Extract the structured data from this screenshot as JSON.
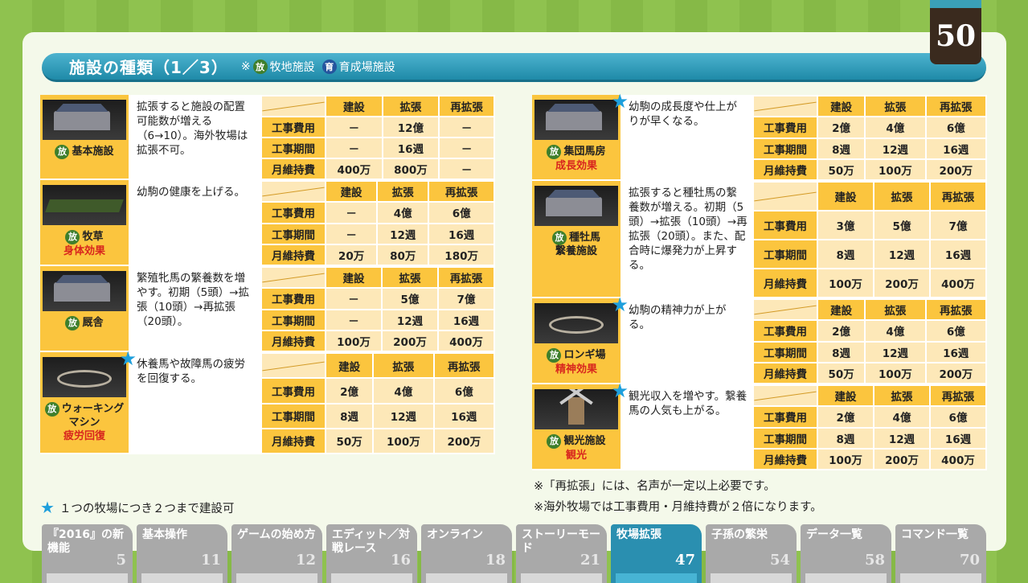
{
  "page_number": "50",
  "title": "施設の種類（1／3）",
  "note": {
    "prefix": "※",
    "badge_pasture": "放",
    "pasture_label": "牧地施設",
    "badge_training": "育",
    "training_label": "育成場施設"
  },
  "table_headers": [
    "建設",
    "拡張",
    "再拡張"
  ],
  "row_labels": [
    "工事費用",
    "工事期間",
    "月維持費"
  ],
  "left_facilities": [
    {
      "badge": "放",
      "name": "基本施設",
      "effect": "",
      "star": false,
      "desc": "拡張すると施設の配置可能数が増える（6→10）。海外牧場は拡張不可。",
      "costs": [
        [
          "－",
          "12億",
          "－"
        ],
        [
          "－",
          "16週",
          "－"
        ],
        [
          "400万",
          "800万",
          "－"
        ]
      ]
    },
    {
      "badge": "放",
      "name": "牧草",
      "effect": "身体効果",
      "star": false,
      "desc": "幼駒の健康を上げる。",
      "costs": [
        [
          "－",
          "4億",
          "6億"
        ],
        [
          "－",
          "12週",
          "16週"
        ],
        [
          "20万",
          "80万",
          "180万"
        ]
      ]
    },
    {
      "badge": "放",
      "name": "厩舎",
      "effect": "",
      "star": false,
      "desc": "繁殖牝馬の繁養数を増やす。初期（5頭）→拡張（10頭）→再拡張（20頭）。",
      "costs": [
        [
          "－",
          "5億",
          "7億"
        ],
        [
          "－",
          "12週",
          "16週"
        ],
        [
          "100万",
          "200万",
          "400万"
        ]
      ]
    },
    {
      "badge": "放",
      "name": "ウォーキング",
      "name2": "マシン",
      "effect": "疲労回復",
      "star": true,
      "desc": "休養馬や故障馬の疲労を回復する。",
      "costs": [
        [
          "2億",
          "4億",
          "6億"
        ],
        [
          "8週",
          "12週",
          "16週"
        ],
        [
          "50万",
          "100万",
          "200万"
        ]
      ]
    }
  ],
  "right_facilities": [
    {
      "badge": "放",
      "name": "集団馬房",
      "effect": "成長効果",
      "star": true,
      "desc": "幼駒の成長度や仕上がりが早くなる。",
      "costs": [
        [
          "2億",
          "4億",
          "6億"
        ],
        [
          "8週",
          "12週",
          "16週"
        ],
        [
          "50万",
          "100万",
          "200万"
        ]
      ]
    },
    {
      "badge": "放",
      "name": "種牡馬",
      "name2": "繋養施設",
      "effect": "",
      "star": false,
      "desc": "拡張すると種牡馬の繋養数が増える。初期（5頭）→拡張（10頭）→再拡張（20頭）。また、配合時に爆発力が上昇する。",
      "costs": [
        [
          "3億",
          "5億",
          "7億"
        ],
        [
          "8週",
          "12週",
          "16週"
        ],
        [
          "100万",
          "200万",
          "400万"
        ]
      ]
    },
    {
      "badge": "放",
      "name": "ロンギ場",
      "effect": "精神効果",
      "star": true,
      "desc": "幼駒の精神力が上がる。",
      "costs": [
        [
          "2億",
          "4億",
          "6億"
        ],
        [
          "8週",
          "12週",
          "16週"
        ],
        [
          "50万",
          "100万",
          "200万"
        ]
      ]
    },
    {
      "badge": "放",
      "name": "観光施設",
      "effect": "観光",
      "star": true,
      "desc": "観光収入を増やす。繋養馬の人気も上がる。",
      "costs": [
        [
          "2億",
          "4億",
          "6億"
        ],
        [
          "8週",
          "12週",
          "16週"
        ],
        [
          "100万",
          "200万",
          "400万"
        ]
      ]
    }
  ],
  "footnotes": [
    "※「再拡張」には、名声が一定以上必要です。",
    "※海外牧場では工事費用・月維持費が２倍になります。"
  ],
  "legend": {
    "star": "★",
    "text": "１つの牧場につき２つまで建設可"
  },
  "tabs": [
    {
      "label": "『2016』の新機能",
      "num": "5",
      "active": false
    },
    {
      "label": "基本操作",
      "num": "11",
      "active": false
    },
    {
      "label": "ゲームの始め方",
      "num": "12",
      "active": false
    },
    {
      "label": "エディット／対戦レース",
      "num": "16",
      "active": false
    },
    {
      "label": "オンライン",
      "num": "18",
      "active": false
    },
    {
      "label": "ストーリーモード",
      "num": "21",
      "active": false
    },
    {
      "label": "牧場拡張",
      "num": "47",
      "active": true
    },
    {
      "label": "子孫の繁栄",
      "num": "54",
      "active": false
    },
    {
      "label": "データ一覧",
      "num": "58",
      "active": false
    },
    {
      "label": "コマンド一覧",
      "num": "70",
      "active": false
    }
  ]
}
